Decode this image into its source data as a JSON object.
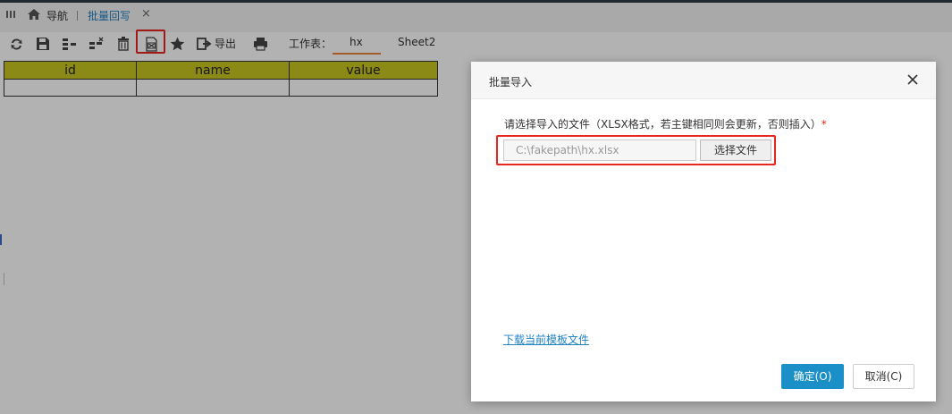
{
  "topbar": {
    "nav_label": "导航",
    "active_tab_label": "批量回写",
    "close_glyph": "×"
  },
  "toolbar": {
    "export_label": "导出",
    "worksheet_label": "工作表：",
    "sheets": [
      "hx",
      "Sheet2"
    ],
    "active_sheet": "hx",
    "icons": [
      "refresh-icon",
      "save-icon",
      "insert-row-icon",
      "delete-row-icon",
      "trash-icon",
      "excel-import-icon",
      "star-icon",
      "export-icon",
      "print-icon"
    ]
  },
  "grid": {
    "columns": [
      "id",
      "name",
      "value"
    ],
    "header_color": "#c9c622"
  },
  "dialog": {
    "title": "批量导入",
    "hint": "请选择导入的文件（XLSX格式，若主键相同则会更新，否则插入）",
    "required_mark": "*",
    "file_path_value": "C:\\fakepath\\hx.xlsx",
    "choose_file_label": "选择文件",
    "download_template_label": "下载当前模板文件",
    "ok_label": "确定(O)",
    "cancel_label": "取消(C)"
  },
  "colors": {
    "accent": "#1b8fc7",
    "highlight": "#e8261f",
    "link": "#1f82c3",
    "sheet_underline": "#e8833a"
  }
}
